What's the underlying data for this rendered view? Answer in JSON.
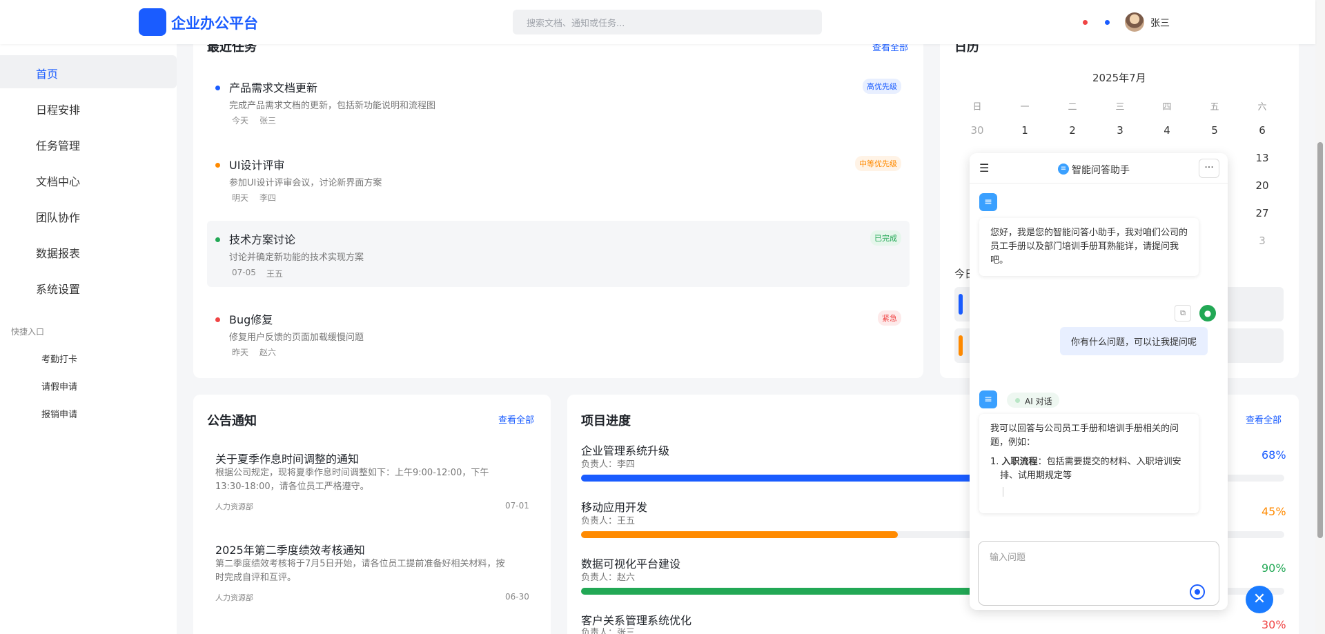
{
  "header": {
    "app_title": "企业办公平台",
    "search_placeholder": "搜索文档、通知或任务...",
    "user_name": "张三",
    "notification_dot_color": "#f04444",
    "message_dot_color": "#1a5cff"
  },
  "sidebar": {
    "items": [
      {
        "label": "首页",
        "active": true
      },
      {
        "label": "日程安排"
      },
      {
        "label": "任务管理"
      },
      {
        "label": "文档中心"
      },
      {
        "label": "团队协作"
      },
      {
        "label": "数据报表"
      },
      {
        "label": "系统设置"
      }
    ],
    "quick_title": "快捷入口",
    "quick_items": [
      "考勤打卡",
      "请假申请",
      "报销申请"
    ]
  },
  "tasks": {
    "title": "最近任务",
    "view_all": "查看全部",
    "items": [
      {
        "title": "产品需求文档更新",
        "desc": "完成产品需求文档的更新，包括新功能说明和流程图",
        "date": "今天",
        "owner": "张三",
        "badge": "高优先级",
        "dot_color": "#1a5cff",
        "badge_color": "#1a5cff",
        "badge_bg": "#e8efff"
      },
      {
        "title": "UI设计评审",
        "desc": "参加UI设计评审会议，讨论新界面方案",
        "date": "明天",
        "owner": "李四",
        "badge": "中等优先级",
        "dot_color": "#ff8a00",
        "badge_color": "#ff8a00",
        "badge_bg": "#fff3e6"
      },
      {
        "title": "技术方案讨论",
        "desc": "讨论并确定新功能的技术实现方案",
        "date": "07-05",
        "owner": "王五",
        "badge": "已完成",
        "dot_color": "#22a855",
        "badge_color": "#22a855",
        "badge_bg": "#e6f6ec"
      },
      {
        "title": "Bug修复",
        "desc": "修复用户反馈的页面加载缓慢问题",
        "date": "昨天",
        "owner": "赵六",
        "badge": "紧急",
        "dot_color": "#f04444",
        "badge_color": "#f04444",
        "badge_bg": "#fdeaea"
      }
    ]
  },
  "calendar": {
    "title": "日历",
    "month": "2025年7月",
    "weekdays": [
      "日",
      "一",
      "二",
      "三",
      "四",
      "五",
      "六"
    ],
    "first_row": [
      "30",
      "1",
      "2",
      "3",
      "4",
      "5",
      "6"
    ],
    "right_col": [
      "13",
      "20",
      "27",
      "3"
    ],
    "today_label": "今日"
  },
  "notices": {
    "title": "公告通知",
    "view_all": "查看全部",
    "items": [
      {
        "title": "关于夏季作息时间调整的通知",
        "body": "根据公司规定，现将夏季作息时间调整如下：上午9:00-12:00，下午13:30-18:00，请各位员工严格遵守。",
        "dept": "人力资源部",
        "date": "07-01"
      },
      {
        "title": "2025年第二季度绩效考核通知",
        "body": "第二季度绩效考核将于7月5日开始，请各位员工提前准备好相关材料，按时完成自评和互评。",
        "dept": "人力资源部",
        "date": "06-30"
      }
    ]
  },
  "projects": {
    "title": "项目进度",
    "view_all": "查看全部",
    "items": [
      {
        "name": "企业管理系统升级",
        "owner": "负责人：李四",
        "percent": "68%",
        "progress": 0.68,
        "color": "#1a5cff"
      },
      {
        "name": "移动应用开发",
        "owner": "负责人：王五",
        "percent": "45%",
        "progress": 0.45,
        "color": "#ff8a00"
      },
      {
        "name": "数据可视化平台建设",
        "owner": "负责人：赵六",
        "percent": "90%",
        "progress": 0.9,
        "color": "#22a855"
      },
      {
        "name": "客户关系管理系统优化",
        "owner": "负责人：张三",
        "percent": "30%",
        "progress": 0.3,
        "color": "#f04444"
      }
    ]
  },
  "chat": {
    "title": "智能问答助手",
    "greeting": "您好，我是您的智能问答小助手，我对咱们公司的员工手册以及部门培训手册耳熟能详，请提问我吧。",
    "user_message": "你有什么问题，可以让我提问呢",
    "ai_tag": "AI 对话",
    "reply_intro": "我可以回答与公司员工手册和培训手册相关的问题，例如：",
    "reply_item_label": "入职流程",
    "reply_item_text": "：包括需要提交的材料、入职培训安排、试用期规定等",
    "input_placeholder": "输入问题"
  }
}
